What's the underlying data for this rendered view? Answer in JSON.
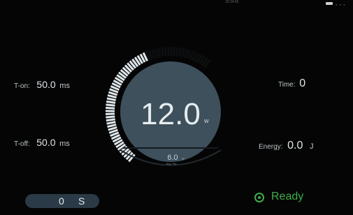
{
  "status": {
    "clock": "18:34:55"
  },
  "left": {
    "ton": {
      "label": "T-on:",
      "value": "50.0",
      "unit": "ms"
    },
    "toff": {
      "label": "T-off:",
      "value": "50.0",
      "unit": "ms"
    }
  },
  "right": {
    "time": {
      "label": "Time:",
      "value": "0"
    },
    "energy": {
      "label": "Energy:",
      "value": "0.0",
      "unit": "J"
    }
  },
  "gauge": {
    "power_value": "12.0",
    "power_unit": "w",
    "sub_value": "6.0",
    "sub_unit": "w",
    "sub_caption": "Avg. Pw",
    "level_fraction": 0.66
  },
  "counter": {
    "value": "0",
    "unit": "S"
  },
  "ready": {
    "label": "Ready"
  },
  "colors": {
    "accent": "#3fae4a",
    "dial": "#3d505c",
    "ticks": "#dfe6ea"
  },
  "icons": [
    "battery-icon",
    "signal-icon",
    "ready-status-icon"
  ]
}
